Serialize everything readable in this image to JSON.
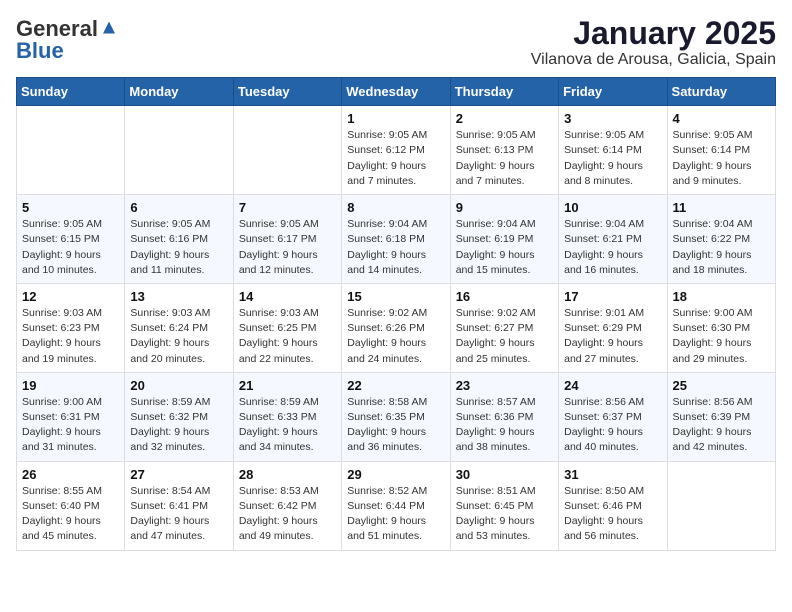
{
  "header": {
    "logo_general": "General",
    "logo_blue": "Blue",
    "month_year": "January 2025",
    "location": "Vilanova de Arousa, Galicia, Spain"
  },
  "weekdays": [
    "Sunday",
    "Monday",
    "Tuesday",
    "Wednesday",
    "Thursday",
    "Friday",
    "Saturday"
  ],
  "weeks": [
    [
      {
        "day": "",
        "info": ""
      },
      {
        "day": "",
        "info": ""
      },
      {
        "day": "",
        "info": ""
      },
      {
        "day": "1",
        "info": "Sunrise: 9:05 AM\nSunset: 6:12 PM\nDaylight: 9 hours and 7 minutes."
      },
      {
        "day": "2",
        "info": "Sunrise: 9:05 AM\nSunset: 6:13 PM\nDaylight: 9 hours and 7 minutes."
      },
      {
        "day": "3",
        "info": "Sunrise: 9:05 AM\nSunset: 6:14 PM\nDaylight: 9 hours and 8 minutes."
      },
      {
        "day": "4",
        "info": "Sunrise: 9:05 AM\nSunset: 6:14 PM\nDaylight: 9 hours and 9 minutes."
      }
    ],
    [
      {
        "day": "5",
        "info": "Sunrise: 9:05 AM\nSunset: 6:15 PM\nDaylight: 9 hours and 10 minutes."
      },
      {
        "day": "6",
        "info": "Sunrise: 9:05 AM\nSunset: 6:16 PM\nDaylight: 9 hours and 11 minutes."
      },
      {
        "day": "7",
        "info": "Sunrise: 9:05 AM\nSunset: 6:17 PM\nDaylight: 9 hours and 12 minutes."
      },
      {
        "day": "8",
        "info": "Sunrise: 9:04 AM\nSunset: 6:18 PM\nDaylight: 9 hours and 14 minutes."
      },
      {
        "day": "9",
        "info": "Sunrise: 9:04 AM\nSunset: 6:19 PM\nDaylight: 9 hours and 15 minutes."
      },
      {
        "day": "10",
        "info": "Sunrise: 9:04 AM\nSunset: 6:21 PM\nDaylight: 9 hours and 16 minutes."
      },
      {
        "day": "11",
        "info": "Sunrise: 9:04 AM\nSunset: 6:22 PM\nDaylight: 9 hours and 18 minutes."
      }
    ],
    [
      {
        "day": "12",
        "info": "Sunrise: 9:03 AM\nSunset: 6:23 PM\nDaylight: 9 hours and 19 minutes."
      },
      {
        "day": "13",
        "info": "Sunrise: 9:03 AM\nSunset: 6:24 PM\nDaylight: 9 hours and 20 minutes."
      },
      {
        "day": "14",
        "info": "Sunrise: 9:03 AM\nSunset: 6:25 PM\nDaylight: 9 hours and 22 minutes."
      },
      {
        "day": "15",
        "info": "Sunrise: 9:02 AM\nSunset: 6:26 PM\nDaylight: 9 hours and 24 minutes."
      },
      {
        "day": "16",
        "info": "Sunrise: 9:02 AM\nSunset: 6:27 PM\nDaylight: 9 hours and 25 minutes."
      },
      {
        "day": "17",
        "info": "Sunrise: 9:01 AM\nSunset: 6:29 PM\nDaylight: 9 hours and 27 minutes."
      },
      {
        "day": "18",
        "info": "Sunrise: 9:00 AM\nSunset: 6:30 PM\nDaylight: 9 hours and 29 minutes."
      }
    ],
    [
      {
        "day": "19",
        "info": "Sunrise: 9:00 AM\nSunset: 6:31 PM\nDaylight: 9 hours and 31 minutes."
      },
      {
        "day": "20",
        "info": "Sunrise: 8:59 AM\nSunset: 6:32 PM\nDaylight: 9 hours and 32 minutes."
      },
      {
        "day": "21",
        "info": "Sunrise: 8:59 AM\nSunset: 6:33 PM\nDaylight: 9 hours and 34 minutes."
      },
      {
        "day": "22",
        "info": "Sunrise: 8:58 AM\nSunset: 6:35 PM\nDaylight: 9 hours and 36 minutes."
      },
      {
        "day": "23",
        "info": "Sunrise: 8:57 AM\nSunset: 6:36 PM\nDaylight: 9 hours and 38 minutes."
      },
      {
        "day": "24",
        "info": "Sunrise: 8:56 AM\nSunset: 6:37 PM\nDaylight: 9 hours and 40 minutes."
      },
      {
        "day": "25",
        "info": "Sunrise: 8:56 AM\nSunset: 6:39 PM\nDaylight: 9 hours and 42 minutes."
      }
    ],
    [
      {
        "day": "26",
        "info": "Sunrise: 8:55 AM\nSunset: 6:40 PM\nDaylight: 9 hours and 45 minutes."
      },
      {
        "day": "27",
        "info": "Sunrise: 8:54 AM\nSunset: 6:41 PM\nDaylight: 9 hours and 47 minutes."
      },
      {
        "day": "28",
        "info": "Sunrise: 8:53 AM\nSunset: 6:42 PM\nDaylight: 9 hours and 49 minutes."
      },
      {
        "day": "29",
        "info": "Sunrise: 8:52 AM\nSunset: 6:44 PM\nDaylight: 9 hours and 51 minutes."
      },
      {
        "day": "30",
        "info": "Sunrise: 8:51 AM\nSunset: 6:45 PM\nDaylight: 9 hours and 53 minutes."
      },
      {
        "day": "31",
        "info": "Sunrise: 8:50 AM\nSunset: 6:46 PM\nDaylight: 9 hours and 56 minutes."
      },
      {
        "day": "",
        "info": ""
      }
    ]
  ]
}
